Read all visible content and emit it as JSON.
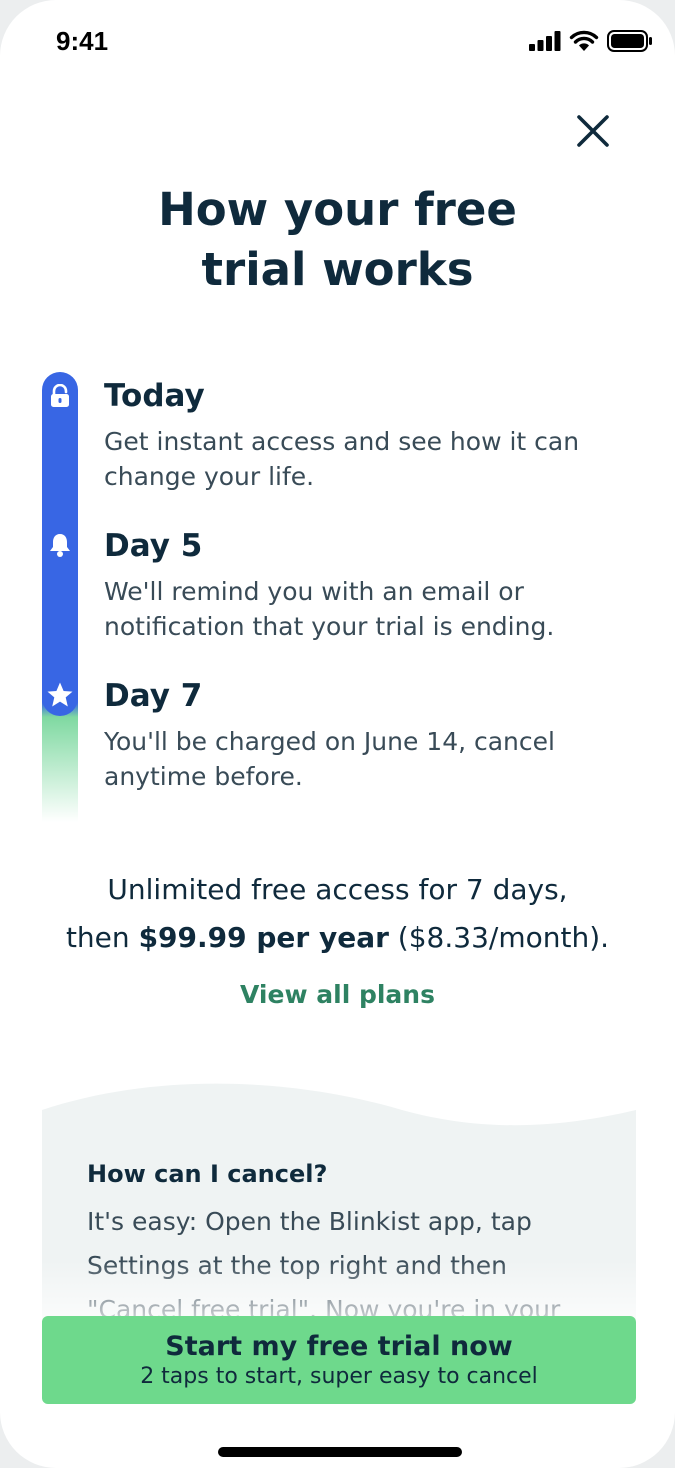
{
  "status_bar": {
    "time": "9:41"
  },
  "title": {
    "line1": "How your free",
    "line2": "trial works"
  },
  "steps": [
    {
      "title": "Today",
      "description": "Get instant access and see how it can change your life.",
      "icon": "lock-icon"
    },
    {
      "title": "Day 5",
      "description": "We'll remind you with an email or notification that your trial is ending.",
      "icon": "bell-icon"
    },
    {
      "title": "Day 7",
      "description": "You'll be charged on June 14, cancel anytime before.",
      "icon": "star-icon"
    }
  ],
  "pricing": {
    "line1": "Unlimited free access for 7 days,",
    "prefix": "then ",
    "price": "$99.99 per year",
    "suffix": " ($8.33/month)."
  },
  "view_plans": "View all plans",
  "faq": {
    "title": "How can I cancel?",
    "body": "It's easy: Open the Blinkist app, tap Settings at the top right and then \"Cancel free trial\". Now you're in your"
  },
  "cta": {
    "title": "Start my free trial now",
    "subtitle": "2 taps to start, super easy to cancel"
  },
  "colors": {
    "accent_blue": "#3866e4",
    "accent_green": "#6ed98c",
    "link_green": "#2e8262",
    "text_dark": "#0f2a3c"
  }
}
